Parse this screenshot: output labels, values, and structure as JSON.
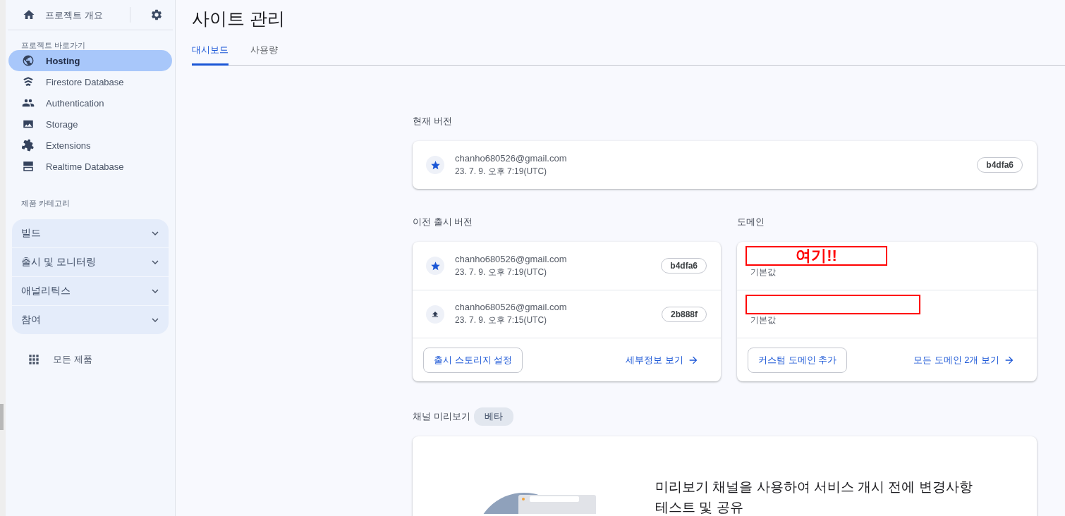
{
  "sidebar": {
    "overview": {
      "label": "프로젝트 개요"
    },
    "shortcuts_heading": "프로젝트 바로가기",
    "shortcuts": [
      {
        "label": "Hosting",
        "selected": true
      },
      {
        "label": "Firestore Database",
        "selected": false
      },
      {
        "label": "Authentication",
        "selected": false
      },
      {
        "label": "Storage",
        "selected": false
      },
      {
        "label": "Extensions",
        "selected": false
      },
      {
        "label": "Realtime Database",
        "selected": false
      }
    ],
    "categories_heading": "제품 카테고리",
    "categories": [
      {
        "label": "빌드",
        "expanded": false
      },
      {
        "label": "출시 및 모니터링",
        "expanded": false
      },
      {
        "label": "애널리틱스",
        "expanded": false
      },
      {
        "label": "참여",
        "expanded": false
      }
    ],
    "all_products": "모든 제품"
  },
  "header": {
    "title": "사이트 관리",
    "tabs": [
      {
        "label": "대시보드",
        "selected": true
      },
      {
        "label": "사용량",
        "selected": false
      }
    ]
  },
  "current_version": {
    "heading": "현재 버전",
    "release": {
      "kind": "live",
      "author": "chanho680526@gmail.com",
      "time": "23. 7. 9. 오후 7:19(UTC)",
      "version": "b4dfa6"
    }
  },
  "previous_releases": {
    "heading": "이전 출시 버전",
    "releases": [
      {
        "kind": "live",
        "author": "chanho680526@gmail.com",
        "time": "23. 7. 9. 오후 7:19(UTC)",
        "version": "b4dfa6"
      },
      {
        "kind": "deployed",
        "author": "chanho680526@gmail.com",
        "time": "23. 7. 9. 오후 7:15(UTC)",
        "version": "2b888f"
      }
    ],
    "button": "출시 스토리지 설정",
    "link": "세부정보 보기"
  },
  "domains": {
    "heading": "도메인",
    "items": [
      {
        "label": "기본값",
        "masked": true,
        "note": "여기!!"
      },
      {
        "label": "기본값",
        "masked": true
      }
    ],
    "button": "커스텀 도메인 추가",
    "link": "모든 도메인 2개 보기"
  },
  "preview_channels": {
    "heading": "채널 미리보기",
    "badge": "베타",
    "description": "미리보기 채널을 사용하여 서비스 개시 전에 변경사항 테스트 및 공유"
  }
}
